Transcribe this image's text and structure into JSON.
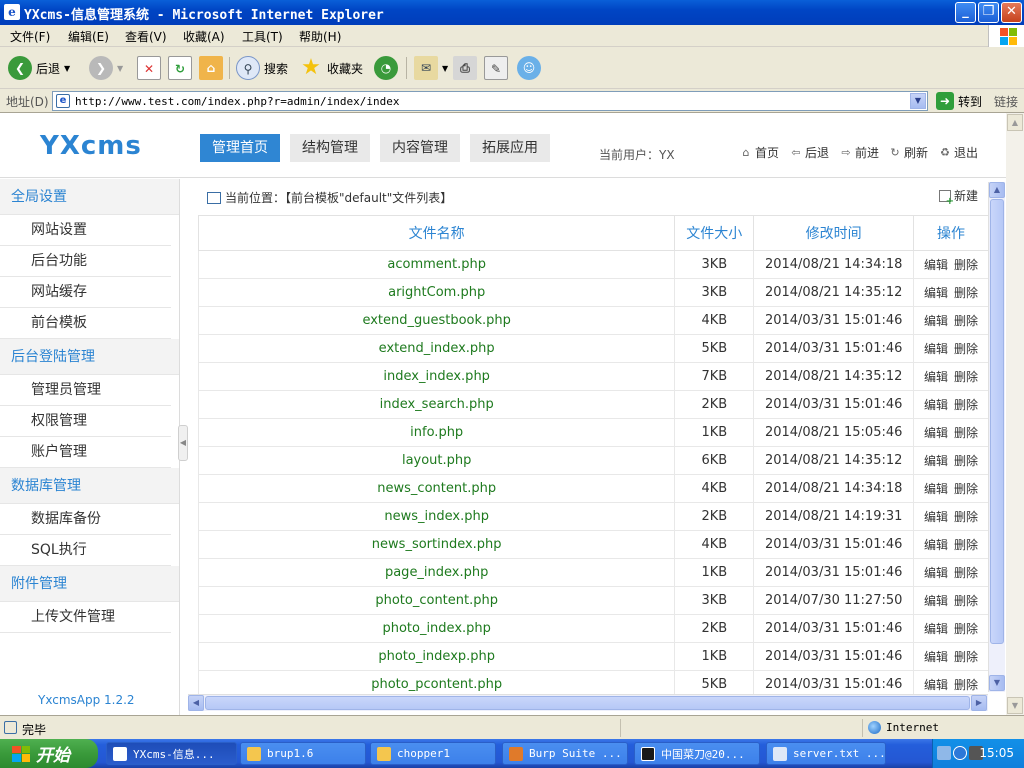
{
  "window": {
    "title": "YXcms-信息管理系统 - Microsoft Internet Explorer",
    "controls": {
      "minimize": "_",
      "maximize": "❐",
      "close": "✕"
    }
  },
  "menu": [
    "文件(F)",
    "编辑(E)",
    "查看(V)",
    "收藏(A)",
    "工具(T)",
    "帮助(H)"
  ],
  "toolbar": {
    "back": "后退",
    "search": "搜索",
    "favorites": "收藏夹"
  },
  "address": {
    "label": "地址(D)",
    "url": "http://www.test.com/index.php?r=admin/index/index",
    "go": "转到",
    "links": "链接"
  },
  "header": {
    "logo": "YXcms",
    "tabs": [
      "管理首页",
      "结构管理",
      "内容管理",
      "拓展应用"
    ],
    "active_tab": 0,
    "current_user": "当前用户：YX",
    "links": [
      {
        "label": "首页",
        "icon": "home-icon"
      },
      {
        "label": "后退",
        "icon": "back-icon"
      },
      {
        "label": "前进",
        "icon": "forward-icon"
      },
      {
        "label": "刷新",
        "icon": "refresh-icon"
      },
      {
        "label": "退出",
        "icon": "logout-icon"
      }
    ]
  },
  "sidebar": {
    "groups": [
      {
        "title": "全局设置",
        "items": [
          "网站设置",
          "后台功能",
          "网站缓存",
          "前台模板"
        ]
      },
      {
        "title": "后台登陆管理",
        "items": [
          "管理员管理",
          "权限管理",
          "账户管理"
        ]
      },
      {
        "title": "数据库管理",
        "items": [
          "数据库备份",
          "SQL执行"
        ]
      },
      {
        "title": "附件管理",
        "items": [
          "上传文件管理"
        ]
      }
    ],
    "footer": "YxcmsApp 1.2.2"
  },
  "main": {
    "breadcrumb": "当前位置：【前台模板\"default\"文件列表】",
    "new_label": "新建",
    "columns": [
      "文件名称",
      "文件大小",
      "修改时间",
      "操作"
    ],
    "edit_label": "编辑",
    "delete_label": "删除",
    "rows": [
      {
        "name": "acomment.php",
        "size": "3KB",
        "time": "2014/08/21 14:34:18"
      },
      {
        "name": "arightCom.php",
        "size": "3KB",
        "time": "2014/08/21 14:35:12"
      },
      {
        "name": "extend_guestbook.php",
        "size": "4KB",
        "time": "2014/03/31 15:01:46"
      },
      {
        "name": "extend_index.php",
        "size": "5KB",
        "time": "2014/03/31 15:01:46"
      },
      {
        "name": "index_index.php",
        "size": "7KB",
        "time": "2014/08/21 14:35:12"
      },
      {
        "name": "index_search.php",
        "size": "2KB",
        "time": "2014/03/31 15:01:46"
      },
      {
        "name": "info.php",
        "size": "1KB",
        "time": "2014/08/21 15:05:46"
      },
      {
        "name": "layout.php",
        "size": "6KB",
        "time": "2014/08/21 14:35:12"
      },
      {
        "name": "news_content.php",
        "size": "4KB",
        "time": "2014/08/21 14:34:18"
      },
      {
        "name": "news_index.php",
        "size": "2KB",
        "time": "2014/08/21 14:19:31"
      },
      {
        "name": "news_sortindex.php",
        "size": "4KB",
        "time": "2014/03/31 15:01:46"
      },
      {
        "name": "page_index.php",
        "size": "1KB",
        "time": "2014/03/31 15:01:46"
      },
      {
        "name": "photo_content.php",
        "size": "3KB",
        "time": "2014/07/30 11:27:50"
      },
      {
        "name": "photo_index.php",
        "size": "2KB",
        "time": "2014/03/31 15:01:46"
      },
      {
        "name": "photo_indexp.php",
        "size": "1KB",
        "time": "2014/03/31 15:01:46"
      },
      {
        "name": "photo_pcontent.php",
        "size": "5KB",
        "time": "2014/03/31 15:01:46"
      }
    ]
  },
  "status": {
    "text": "完毕",
    "zone": "Internet"
  },
  "taskbar": {
    "start": "开始",
    "tasks": [
      "YXcms-信息...",
      "brup1.6",
      "chopper1",
      "Burp Suite ...",
      "中国菜刀@20...",
      "server.txt ..."
    ],
    "active_task": 0,
    "clock": "15:05"
  },
  "colors": {
    "accent": "#2b84d2",
    "active_tab_bg": "#2f86d3",
    "filename": "#1e7a1e"
  }
}
